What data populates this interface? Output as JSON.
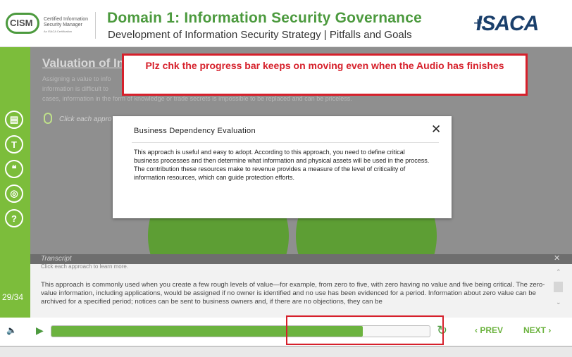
{
  "header": {
    "logo_text": "CISM",
    "logo_line1": "Certified Information",
    "logo_line2": "Security Manager",
    "logo_line3": "An ISACA Certification",
    "title": "Domain 1: Information Security Governance",
    "subtitle": "Development of Information Security Strategy | Pitfalls and Goals",
    "brand": "ISACA",
    "brand_mark": "+"
  },
  "sidebar": {
    "items": [
      {
        "icon": "notes-icon",
        "glyph": "▤"
      },
      {
        "icon": "text-icon",
        "glyph": "T"
      },
      {
        "icon": "quote-icon",
        "glyph": "❝"
      },
      {
        "icon": "resources-icon",
        "glyph": "◎"
      },
      {
        "icon": "help-icon",
        "glyph": "?"
      }
    ],
    "slide_counter": "29/34"
  },
  "slide": {
    "heading": "Valuation of Inf",
    "body_line1": "Assigning a value to info",
    "body_line2": "information is difficult to",
    "body_line3": "cases, information in the form of knowledge or trade secrets is impossible to be replaced and can be priceless.",
    "click_instruction": "Click each appro"
  },
  "annotation": {
    "message": "Plz chk the progress bar keeps on moving even when the Audio has finishes"
  },
  "modal": {
    "title": "Business Dependency Evaluation",
    "close_glyph": "✕",
    "body": "This approach is useful and easy to adopt. According to this approach, you need to define critical business processes and then determine what information and physical assets will be used in the process. The contribution these resources make to revenue provides a measure of the level of criticality of information resources, which can guide protection efforts."
  },
  "transcript": {
    "label": "Transcript",
    "close_glyph": "✕",
    "partial_line": "Click each approach to learn more.",
    "text": "This approach is commonly used when you create a few rough levels of value—for example, from zero to five, with zero having no value and five being critical. The zero-value information, including applications, would be assigned if no owner is identified and no use has been evidenced for a period. Information about zero value can be archived for a specified period; notices can be sent to business owners and, if there are no objections, they can be"
  },
  "controls": {
    "progress_fraction": 0.823,
    "prev_label": "‹ PREV",
    "next_label": "NEXT ›",
    "replay_glyph": "↻",
    "play_glyph": "▶",
    "speaker_glyph": "🔈"
  },
  "colors": {
    "accent_green": "#7cbd3b",
    "title_green": "#4c9a3e",
    "annotation_red": "#d6202b",
    "brand_blue": "#1a3f6b"
  }
}
